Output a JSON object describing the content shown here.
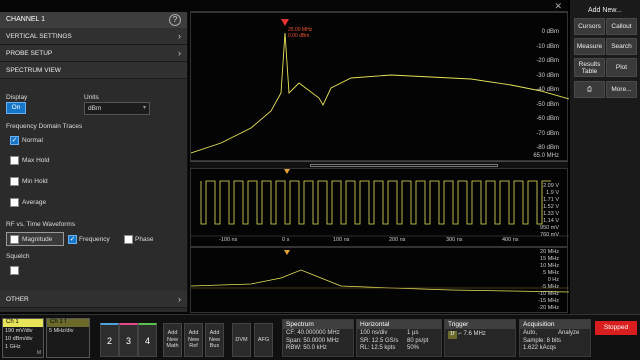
{
  "panel": {
    "title": "CHANNEL 1",
    "help_icon": "?",
    "sections": {
      "vertical": "VERTICAL SETTINGS",
      "probe": "PROBE SETUP",
      "spectrum": "SPECTRUM VIEW",
      "other": "OTHER"
    },
    "display_label": "Display",
    "display_value": "On",
    "units_label": "Units",
    "units_value": "dBm",
    "fd_traces_label": "Frequency Domain Traces",
    "traces": [
      "Normal",
      "Max Hold",
      "Min Hold",
      "Average"
    ],
    "rf_label": "RF vs. Time Waveforms",
    "rf_options": [
      "Magnitude",
      "Frequency",
      "Phase"
    ],
    "squelch_label": "Squelch"
  },
  "right_panel": {
    "add_new": "Add New...",
    "buttons": [
      "Cursors",
      "Callout",
      "Measure",
      "Search",
      "Results Table",
      "Plot",
      "More..."
    ]
  },
  "spectrum_pane": {
    "scale": [
      "0 dBm",
      "-10 dBm",
      "-20 dBm",
      "-30 dBm",
      "-40 dBm",
      "-50 dBm",
      "-60 dBm",
      "-70 dBm",
      "-80 dBm"
    ],
    "freq_readout": "65.0 MHz",
    "marker_text_1": "25.00 MHz",
    "marker_text_2": "0.00 dBm"
  },
  "time_pane": {
    "scale": [
      "2.09 V",
      "1.9 V",
      "1.71 V",
      "1.52 V",
      "1.33 V",
      "1.14 V",
      "950 mV",
      "760 mV"
    ],
    "time_ticks": [
      "-100 ns",
      "0 s",
      "100 ns",
      "200 ns",
      "300 ns",
      "400 ns"
    ]
  },
  "freq_pane": {
    "scale": [
      "20 MHz",
      "15 MHz",
      "10 MHz",
      "5 MHz",
      "0 Hz",
      "-5 MHz",
      "-10 MHz",
      "-15 MHz",
      "-20 MHz"
    ]
  },
  "bottom": {
    "ch1_label": "Ch 1",
    "ch1_vals": [
      "190 mV/div",
      "10 dBm/div",
      "1 GHz"
    ],
    "ch1_suffix": "M",
    "ch1f_label": "Ch 1 f",
    "ch1f_val": "5 MHz/div",
    "channels": [
      "2",
      "3",
      "4"
    ],
    "add_buttons": [
      [
        "Add",
        "New",
        "Math"
      ],
      [
        "Add",
        "New",
        "Ref"
      ],
      [
        "Add",
        "New",
        "Bus"
      ]
    ],
    "dvm": "DVM",
    "afg": "AFG",
    "spectrum_title": "Spectrum",
    "spectrum_vals": [
      "CF: 40.000000 MHz",
      "Span: 50.0000 MHz",
      "RBW: 50.0 kHz"
    ],
    "horizontal_title": "Horizontal",
    "horizontal_vals": [
      "100 ns/div",
      "SR: 12.5 GS/s",
      "RL: 12.5 kpts"
    ],
    "horizontal_vals2": [
      "1 µs",
      "80 ps/pt",
      "50%"
    ],
    "trigger_title": "Trigger",
    "trigger_vals": [
      "7.6 MHz"
    ],
    "trigger_badge": "1f",
    "acq_title": "Acquisition",
    "acq_vals": [
      "Auto,",
      "Sample: 8 bits",
      "1.622 kAcqs"
    ],
    "acq_vals2": [
      "Analyze"
    ],
    "stopped": "Stopped"
  }
}
